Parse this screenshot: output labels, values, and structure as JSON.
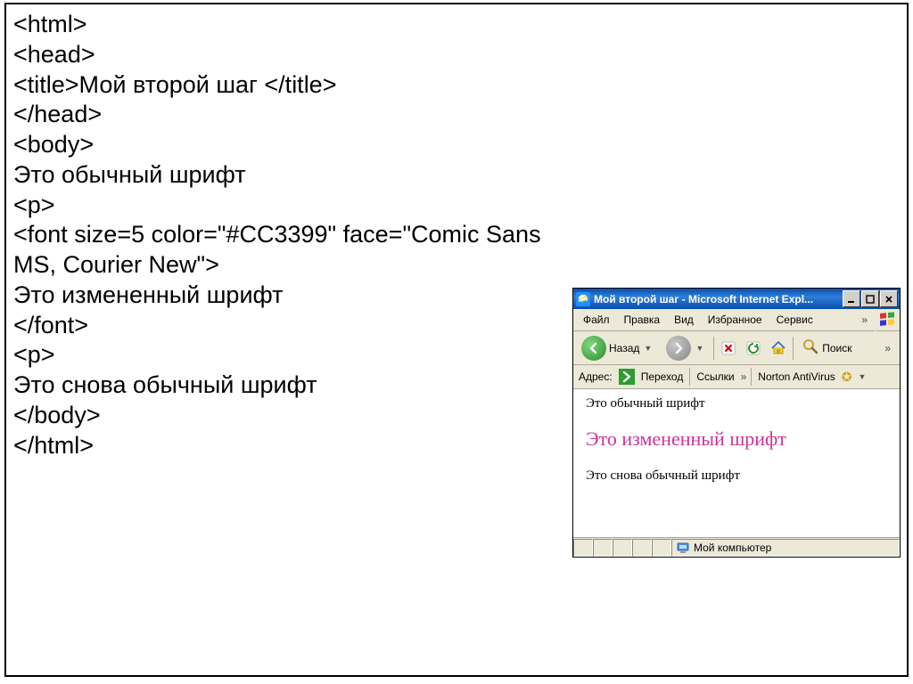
{
  "code": {
    "lines": [
      "<html>",
      "<head>",
      "<title>Мой второй шаг </title>",
      "</head>",
      "<body>",
      "Это обычный шрифт",
      "<p>",
      "<font size=5 color=\"#CC3399\" face=\"Comic Sans MS, Courier New\">",
      "Это измененный шрифт",
      "</font>",
      "<p>",
      "Это снова обычный шрифт",
      "</body>",
      "</html>"
    ]
  },
  "browser": {
    "title": "Мой второй шаг - Microsoft Internet Expl...",
    "menu": {
      "file": "Файл",
      "edit": "Правка",
      "view": "Вид",
      "favorites": "Избранное",
      "service": "Сервис",
      "chevron": "»"
    },
    "toolbar": {
      "back": "Назад",
      "search": "Поиск",
      "chevron": "»"
    },
    "addressbar": {
      "label": "Адрес:",
      "go": "Переход",
      "links": "Ссылки",
      "norton": "Norton AntiVirus",
      "chevron": "»"
    },
    "content": {
      "line1": "Это обычный шрифт",
      "line2": "Это измененный шрифт",
      "line2_color": "#CC3399",
      "line3": "Это снова обычный шрифт"
    },
    "statusbar": {
      "text": "Мой компьютер"
    }
  }
}
